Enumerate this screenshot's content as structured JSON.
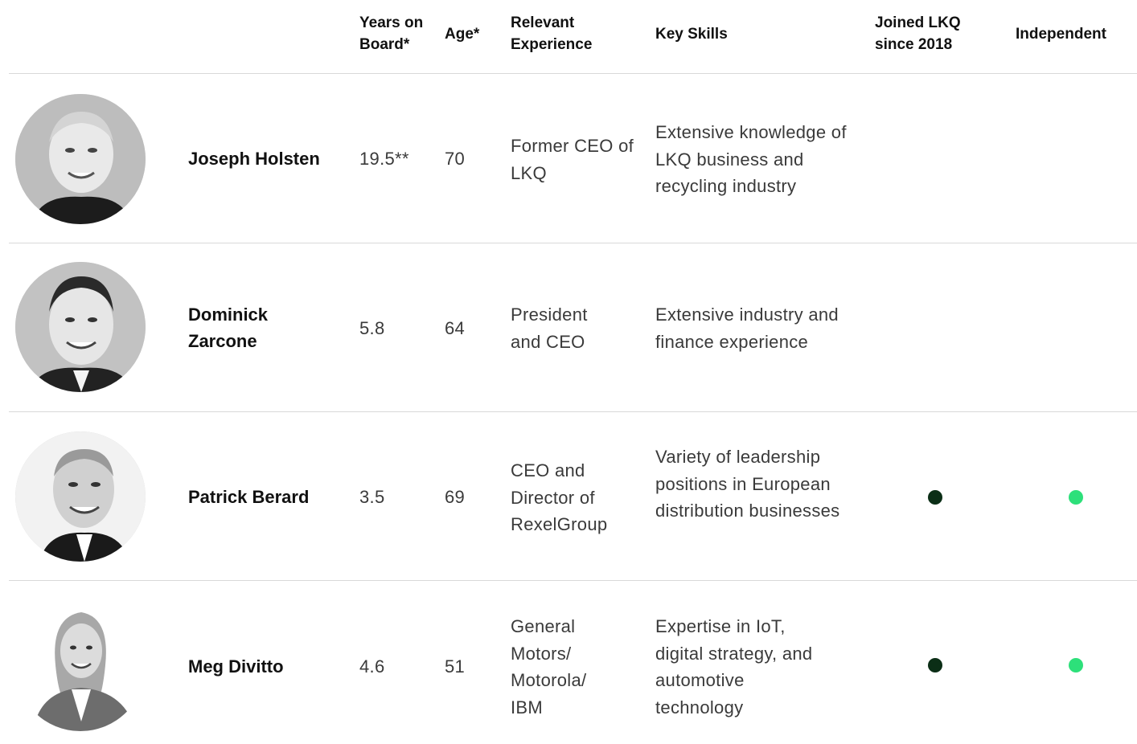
{
  "colors": {
    "joined_dot": "#0b2e16",
    "independent_dot": "#2de07a",
    "divider": "#d9d9d9"
  },
  "header": {
    "years": "Years on Board*",
    "age": "Age*",
    "experience": "Relevant Experience",
    "skills": "Key Skills",
    "joined": "Joined LKQ since 2018",
    "independent": "Independent"
  },
  "rows": [
    {
      "name": "Joseph Holsten",
      "years": "19.5**",
      "age": "70",
      "experience": "Former CEO of LKQ",
      "skills": "Extensive knowledge of LKQ business and recycling industry",
      "joined": false,
      "independent": false
    },
    {
      "name": "Dominick Zarcone",
      "years": "5.8",
      "age": "64",
      "experience": "President and CEO",
      "skills": "Extensive industry and finance experience",
      "joined": false,
      "independent": false
    },
    {
      "name": "Patrick Berard",
      "years": "3.5",
      "age": "69",
      "experience": "CEO and Director of RexelGroup",
      "skills": "Variety of leadership positions in European distribution businesses",
      "joined": true,
      "independent": true
    },
    {
      "name": "Meg Divitto",
      "years": "4.6",
      "age": "51",
      "experience": "General Motors/ Motorola/ IBM",
      "skills": "Expertise in IoT, digital strategy, and automotive technology",
      "joined": true,
      "independent": true
    }
  ]
}
